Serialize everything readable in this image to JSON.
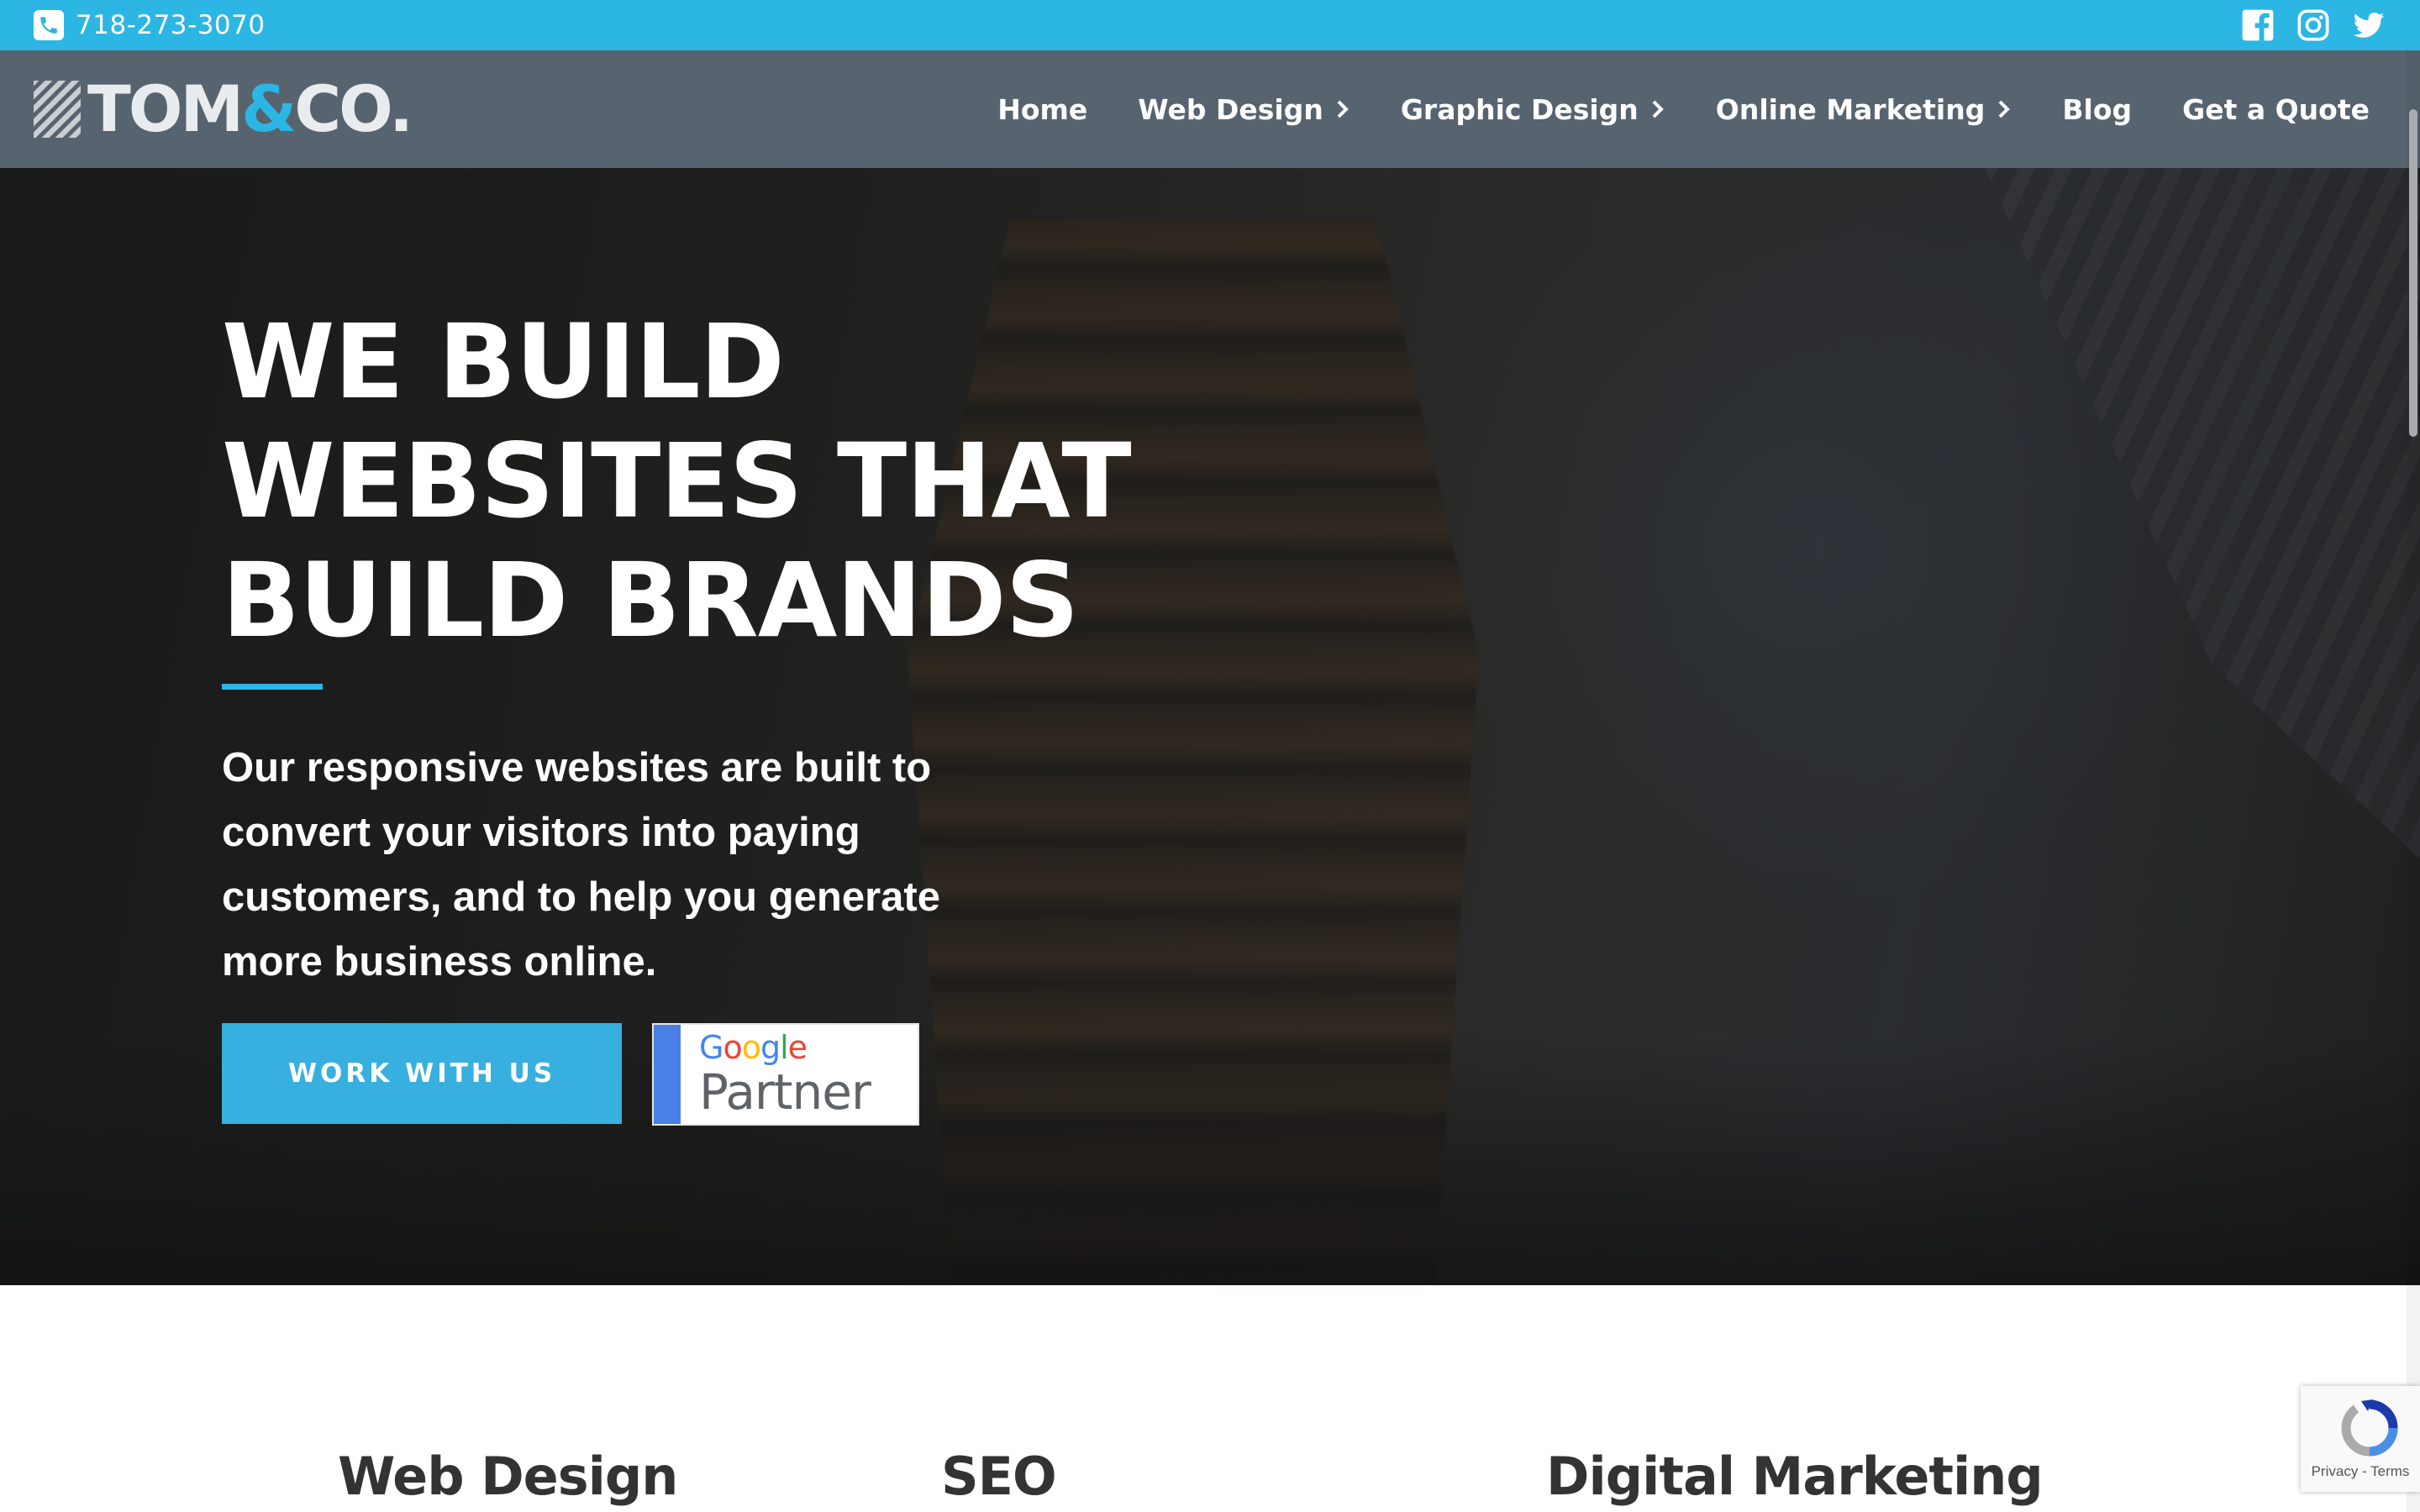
{
  "topbar": {
    "phone": "718-273-3070",
    "social_icons": [
      "facebook-icon",
      "instagram-icon",
      "twitter-icon"
    ],
    "background": "#2cb6e4"
  },
  "brand": {
    "logo_text_left": "TOM",
    "logo_text_amp": "&",
    "logo_text_right": "CO.",
    "accent": "#2cb6e4"
  },
  "nav": {
    "items": [
      {
        "label": "Home",
        "has_dropdown": false
      },
      {
        "label": "Web Design",
        "has_dropdown": true
      },
      {
        "label": "Graphic Design",
        "has_dropdown": true
      },
      {
        "label": "Online Marketing",
        "has_dropdown": true
      },
      {
        "label": "Blog",
        "has_dropdown": false
      },
      {
        "label": "Get a Quote",
        "has_dropdown": false
      }
    ],
    "background": "#57636e"
  },
  "hero": {
    "headline_lines": [
      "WE BUILD",
      "WEBSITES THAT",
      "BUILD BRANDS"
    ],
    "subtext": "Our responsive websites are built to convert your visitors into paying customers, and to help you generate more business online.",
    "cta_label": "WORK WITH US",
    "badge": {
      "google": "Google",
      "partner": "Partner"
    }
  },
  "services": {
    "items": [
      "Web Design",
      "SEO",
      "Digital Marketing"
    ]
  },
  "recaptcha": {
    "links": "Privacy - Terms"
  }
}
